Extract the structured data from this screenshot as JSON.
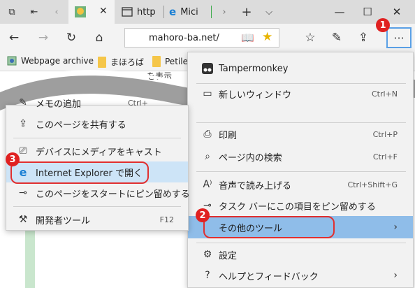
{
  "browser": {
    "tabs": [
      {
        "label": "http"
      },
      {
        "label": "Mici"
      }
    ],
    "address": "mahoro-ba.net/",
    "accent": "#0078d7"
  },
  "favorites": [
    {
      "label": "Webpage archive"
    },
    {
      "label": "まほろば"
    },
    {
      "label": "Petile"
    }
  ],
  "behind_text": "を表示",
  "left_menu": {
    "items": [
      {
        "label": "メモの追加",
        "shortcut": "Ctrl+"
      },
      {
        "label": "このページを共有する"
      },
      {
        "label": "デバイスにメディアをキャスト"
      },
      {
        "label": "Internet Explorer で開く"
      },
      {
        "label": "このページをスタートにピン留めする"
      },
      {
        "label": "開発者ツール",
        "shortcut": "F12"
      }
    ]
  },
  "right_menu": {
    "items": [
      {
        "label": "Tampermonkey"
      },
      {
        "label": "新しいウィンドウ",
        "shortcut": "Ctrl+N"
      },
      {
        "label": "印刷",
        "shortcut": "Ctrl+P"
      },
      {
        "label": "ページ内の検索",
        "shortcut": "Ctrl+F"
      },
      {
        "label": "音声で読み上げる",
        "shortcut": "Ctrl+Shift+G"
      },
      {
        "label": "タスク バーにこの項目をピン留めする"
      },
      {
        "label": "その他のツール"
      },
      {
        "label": "設定"
      },
      {
        "label": "ヘルプとフィードバック"
      }
    ]
  },
  "badges": [
    "1",
    "2",
    "3"
  ],
  "colors": {
    "badge": "#e02121",
    "highlight_blue": "#8fbde9",
    "highlight_light": "#cde4f7",
    "oval": "#e12f2f"
  }
}
